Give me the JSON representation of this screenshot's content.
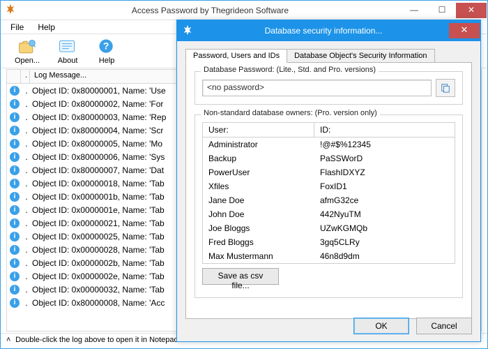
{
  "window": {
    "title": "Access Password by Thegrideon Software",
    "menu": {
      "file": "File",
      "help": "Help"
    },
    "toolbar": {
      "open": "Open...",
      "about": "About",
      "help": "Help"
    },
    "log_header": {
      "c1": "",
      "c2": ".",
      "c3": "Log Message..."
    },
    "log_rows": [
      "Object ID: 0x80000001, Name: 'Use",
      "Object ID: 0x80000002, Name: 'For",
      "Object ID: 0x80000003, Name: 'Rep",
      "Object ID: 0x80000004, Name: 'Scr",
      "Object ID: 0x80000005, Name: 'Mo",
      "Object ID: 0x80000006, Name: 'Sys",
      "Object ID: 0x80000007, Name: 'Dat",
      "Object ID: 0x00000018, Name: 'Tab",
      "Object ID: 0x0000001b, Name: 'Tab",
      "Object ID: 0x0000001e, Name: 'Tab",
      "Object ID: 0x00000021, Name: 'Tab",
      "Object ID: 0x00000025, Name: 'Tab",
      "Object ID: 0x00000028, Name: 'Tab",
      "Object ID: 0x0000002b, Name: 'Tab",
      "Object ID: 0x0000002e, Name: 'Tab",
      "Object ID: 0x00000032, Name: 'Tab",
      "Object ID: 0x80000008, Name: 'Acc"
    ],
    "status": "Double-click the log above to open it in Notepad"
  },
  "dialog": {
    "title": "Database security information...",
    "tab1": "Password, Users and IDs",
    "tab2": "Database Object's Security Information",
    "group1_label": "Database Password: (Lite., Std. and Pro. versions)",
    "password_value": "<no password>",
    "group2_label": "Non-standard database owners: (Pro. version only)",
    "col_user": "User:",
    "col_id": "ID:",
    "owners": [
      {
        "user": "Administrator",
        "id": "!@#$%12345"
      },
      {
        "user": "Backup",
        "id": "PaSSWorD"
      },
      {
        "user": "PowerUser",
        "id": "FlashIDXYZ"
      },
      {
        "user": "Xfiles",
        "id": "FoxID1"
      },
      {
        "user": "Jane Doe",
        "id": "afmG32ce"
      },
      {
        "user": "John Doe",
        "id": "442NyuTM"
      },
      {
        "user": "Joe Bloggs",
        "id": "UZwKGMQb"
      },
      {
        "user": "Fred Bloggs",
        "id": "3gq5CLRy"
      },
      {
        "user": "Max Mustermann",
        "id": "46n8d9dm"
      }
    ],
    "save_label": "Save as csv file...",
    "ok": "OK",
    "cancel": "Cancel"
  }
}
